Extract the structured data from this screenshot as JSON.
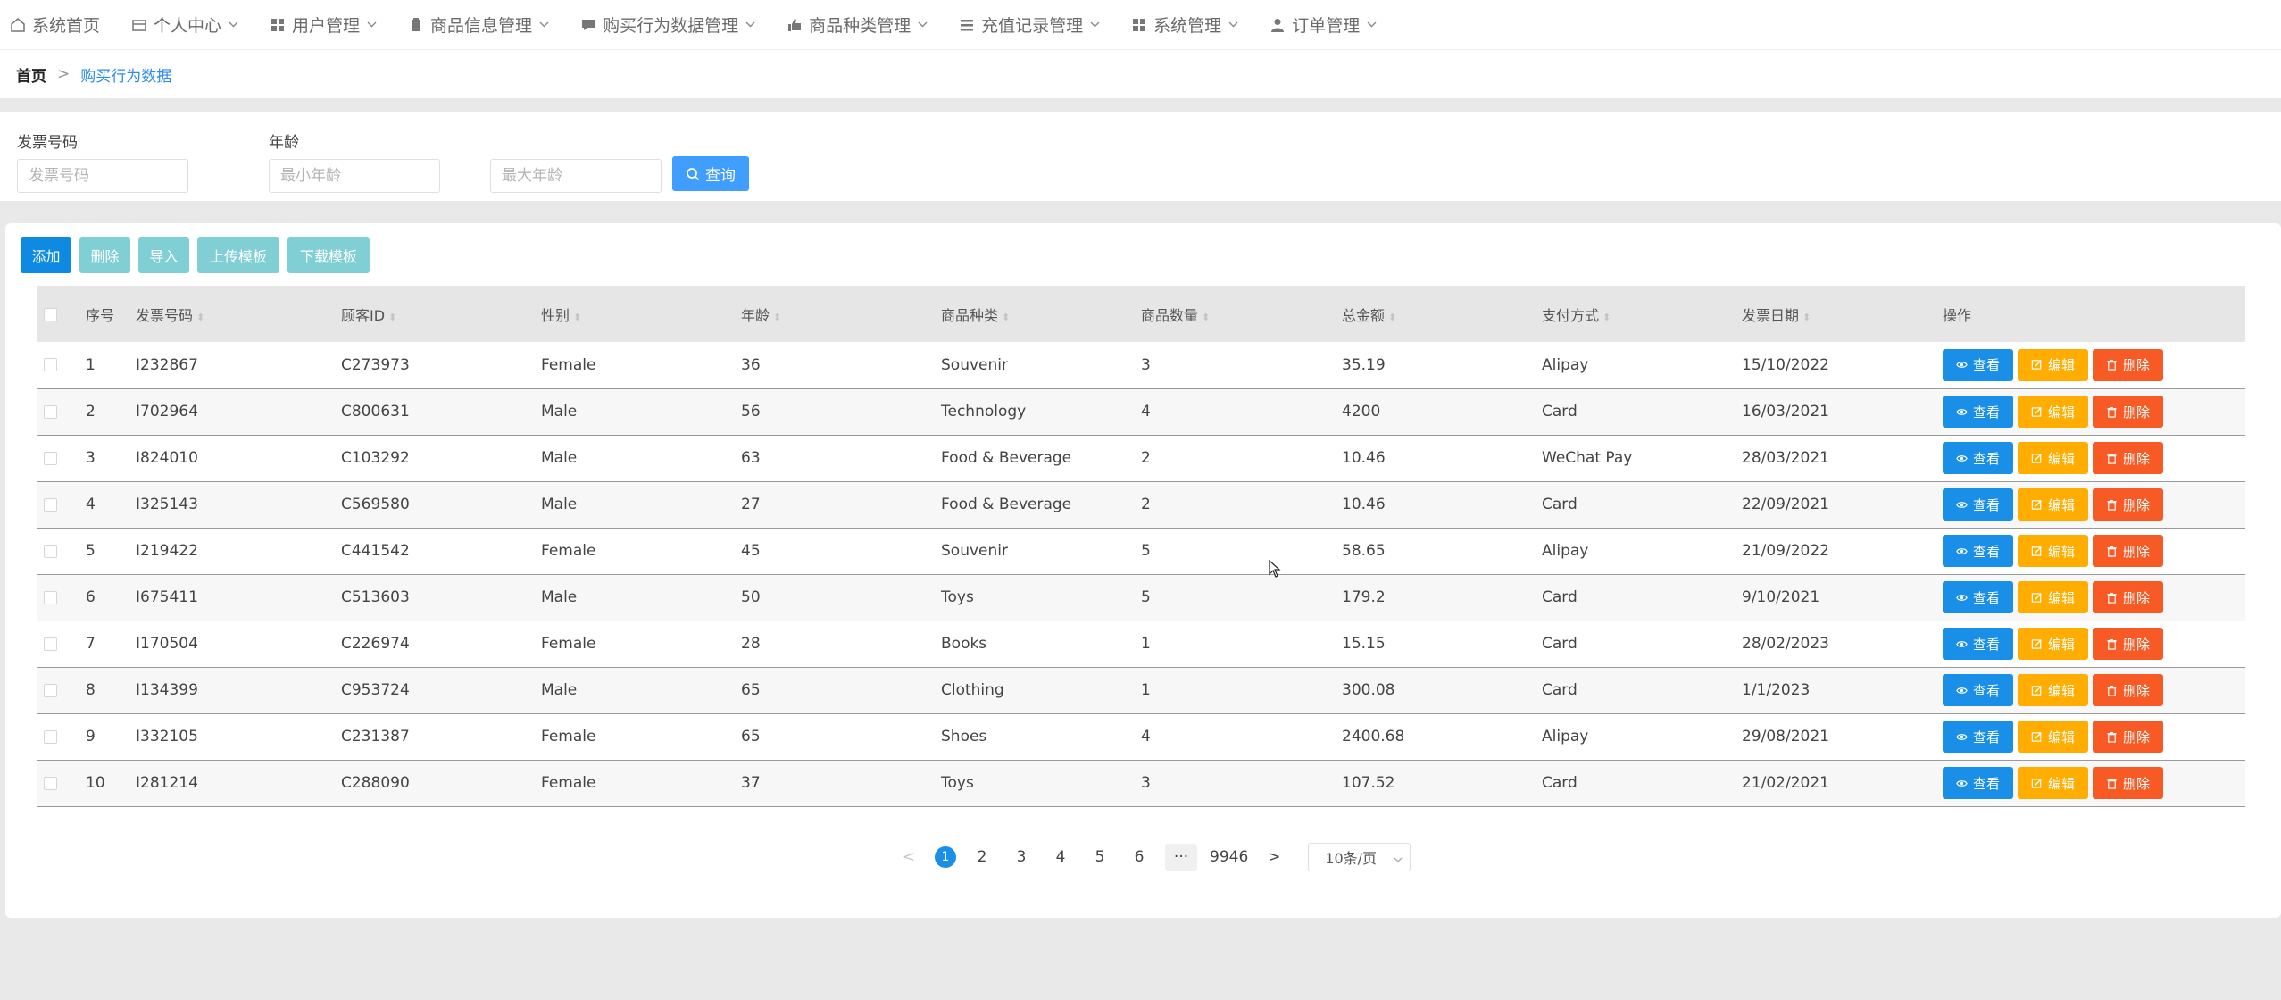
{
  "nav": {
    "items": [
      {
        "label": "系统首页",
        "icon": "home-icon",
        "has_dropdown": false
      },
      {
        "label": "个人中心",
        "icon": "card-icon",
        "has_dropdown": true
      },
      {
        "label": "用户管理",
        "icon": "grid-icon",
        "has_dropdown": true
      },
      {
        "label": "商品信息管理",
        "icon": "clipboard-icon",
        "has_dropdown": true
      },
      {
        "label": "购买行为数据管理",
        "icon": "chat-icon",
        "has_dropdown": true
      },
      {
        "label": "商品种类管理",
        "icon": "thumb-icon",
        "has_dropdown": true
      },
      {
        "label": "充值记录管理",
        "icon": "list-icon",
        "has_dropdown": true
      },
      {
        "label": "系统管理",
        "icon": "grid-icon",
        "has_dropdown": true
      },
      {
        "label": "订单管理",
        "icon": "user-icon",
        "has_dropdown": true
      }
    ]
  },
  "breadcrumb": {
    "home": "首页",
    "separator": ">",
    "current": "购买行为数据"
  },
  "search": {
    "invoice_label": "发票号码",
    "invoice_placeholder": "发票号码",
    "age_label": "年龄",
    "min_age_placeholder": "最小年龄",
    "max_age_placeholder": "最大年龄",
    "query_label": "查询"
  },
  "toolbar": {
    "add": "添加",
    "delete": "删除",
    "import": "导入",
    "upload_template": "上传模板",
    "download_template": "下载模板"
  },
  "table": {
    "headers": {
      "index": "序号",
      "invoice_no": "发票号码",
      "customer_id": "顾客ID",
      "gender": "性别",
      "age": "年龄",
      "category": "商品种类",
      "quantity": "商品数量",
      "total": "总金额",
      "payment": "支付方式",
      "invoice_date": "发票日期",
      "actions": "操作"
    },
    "rows": [
      {
        "index": "1",
        "invoice_no": "I232867",
        "customer_id": "C273973",
        "gender": "Female",
        "age": "36",
        "category": "Souvenir",
        "quantity": "3",
        "total": "35.19",
        "payment": "Alipay",
        "invoice_date": "15/10/2022"
      },
      {
        "index": "2",
        "invoice_no": "I702964",
        "customer_id": "C800631",
        "gender": "Male",
        "age": "56",
        "category": "Technology",
        "quantity": "4",
        "total": "4200",
        "payment": "Card",
        "invoice_date": "16/03/2021"
      },
      {
        "index": "3",
        "invoice_no": "I824010",
        "customer_id": "C103292",
        "gender": "Male",
        "age": "63",
        "category": "Food & Beverage",
        "quantity": "2",
        "total": "10.46",
        "payment": "WeChat Pay",
        "invoice_date": "28/03/2021"
      },
      {
        "index": "4",
        "invoice_no": "I325143",
        "customer_id": "C569580",
        "gender": "Male",
        "age": "27",
        "category": "Food & Beverage",
        "quantity": "2",
        "total": "10.46",
        "payment": "Card",
        "invoice_date": "22/09/2021"
      },
      {
        "index": "5",
        "invoice_no": "I219422",
        "customer_id": "C441542",
        "gender": "Female",
        "age": "45",
        "category": "Souvenir",
        "quantity": "5",
        "total": "58.65",
        "payment": "Alipay",
        "invoice_date": "21/09/2022"
      },
      {
        "index": "6",
        "invoice_no": "I675411",
        "customer_id": "C513603",
        "gender": "Male",
        "age": "50",
        "category": "Toys",
        "quantity": "5",
        "total": "179.2",
        "payment": "Card",
        "invoice_date": "9/10/2021"
      },
      {
        "index": "7",
        "invoice_no": "I170504",
        "customer_id": "C226974",
        "gender": "Female",
        "age": "28",
        "category": "Books",
        "quantity": "1",
        "total": "15.15",
        "payment": "Card",
        "invoice_date": "28/02/2023"
      },
      {
        "index": "8",
        "invoice_no": "I134399",
        "customer_id": "C953724",
        "gender": "Male",
        "age": "65",
        "category": "Clothing",
        "quantity": "1",
        "total": "300.08",
        "payment": "Card",
        "invoice_date": "1/1/2023"
      },
      {
        "index": "9",
        "invoice_no": "I332105",
        "customer_id": "C231387",
        "gender": "Female",
        "age": "65",
        "category": "Shoes",
        "quantity": "4",
        "total": "2400.68",
        "payment": "Alipay",
        "invoice_date": "29/08/2021"
      },
      {
        "index": "10",
        "invoice_no": "I281214",
        "customer_id": "C288090",
        "gender": "Female",
        "age": "37",
        "category": "Toys",
        "quantity": "3",
        "total": "107.52",
        "payment": "Card",
        "invoice_date": "21/02/2021"
      }
    ],
    "row_actions": {
      "view": "查看",
      "edit": "编辑",
      "delete": "删除"
    }
  },
  "pagination": {
    "prev": "<",
    "pages": [
      "1",
      "2",
      "3",
      "4",
      "5",
      "6"
    ],
    "current": "1",
    "ellipsis": "···",
    "last": "9946",
    "next": ">",
    "page_size": "10条/页"
  },
  "colors": {
    "primary": "#409eff",
    "add_button": "#0f8ae3",
    "muted_button": "#7fcfd4",
    "view_button": "#1a8fe8",
    "edit_button": "#ffad00",
    "delete_button": "#f75a25"
  }
}
